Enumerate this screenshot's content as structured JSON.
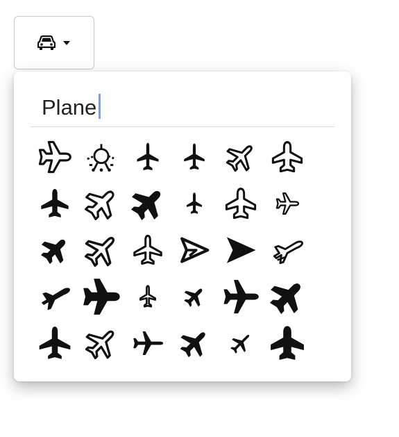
{
  "trigger": {
    "icon": "car-icon",
    "caret_icon": "caret-down-icon"
  },
  "search": {
    "value": "Plane",
    "placeholder": ""
  },
  "icons": [
    {
      "name": "plane-outline-tilted-icon"
    },
    {
      "name": "plane-departure-gauge-icon"
    },
    {
      "name": "plane-up-icon"
    },
    {
      "name": "plane-up-icon"
    },
    {
      "name": "plane-outline-diagonal-icon"
    },
    {
      "name": "plane-outline-up-icon"
    },
    {
      "name": "plane-solid-up-icon"
    },
    {
      "name": "plane-outline-diagonal-icon"
    },
    {
      "name": "plane-solid-bold-diagonal-icon"
    },
    {
      "name": "plane-thin-up-icon"
    },
    {
      "name": "plane-outline-up-icon"
    },
    {
      "name": "plane-small-outline-right-icon"
    },
    {
      "name": "plane-bold-diagonal-icon"
    },
    {
      "name": "plane-outline-large-diagonal-icon"
    },
    {
      "name": "plane-outline-up-icon"
    },
    {
      "name": "paper-plane-outline-icon"
    },
    {
      "name": "paper-plane-solid-icon"
    },
    {
      "name": "plane-departure-outline-icon"
    },
    {
      "name": "plane-departure-solid-icon"
    },
    {
      "name": "plane-solid-right-icon"
    },
    {
      "name": "plane-outline-small-up-icon"
    },
    {
      "name": "plane-small-diagonal-icon"
    },
    {
      "name": "plane-solid-right-icon"
    },
    {
      "name": "plane-solid-bold-diagonal-icon"
    },
    {
      "name": "plane-solid-up-icon"
    },
    {
      "name": "plane-outline-diagonal-icon"
    },
    {
      "name": "plane-thin-right-icon"
    },
    {
      "name": "plane-solid-diagonal-icon"
    },
    {
      "name": "plane-small-diagonal-icon"
    },
    {
      "name": "plane-solid-bold-up-icon"
    }
  ]
}
